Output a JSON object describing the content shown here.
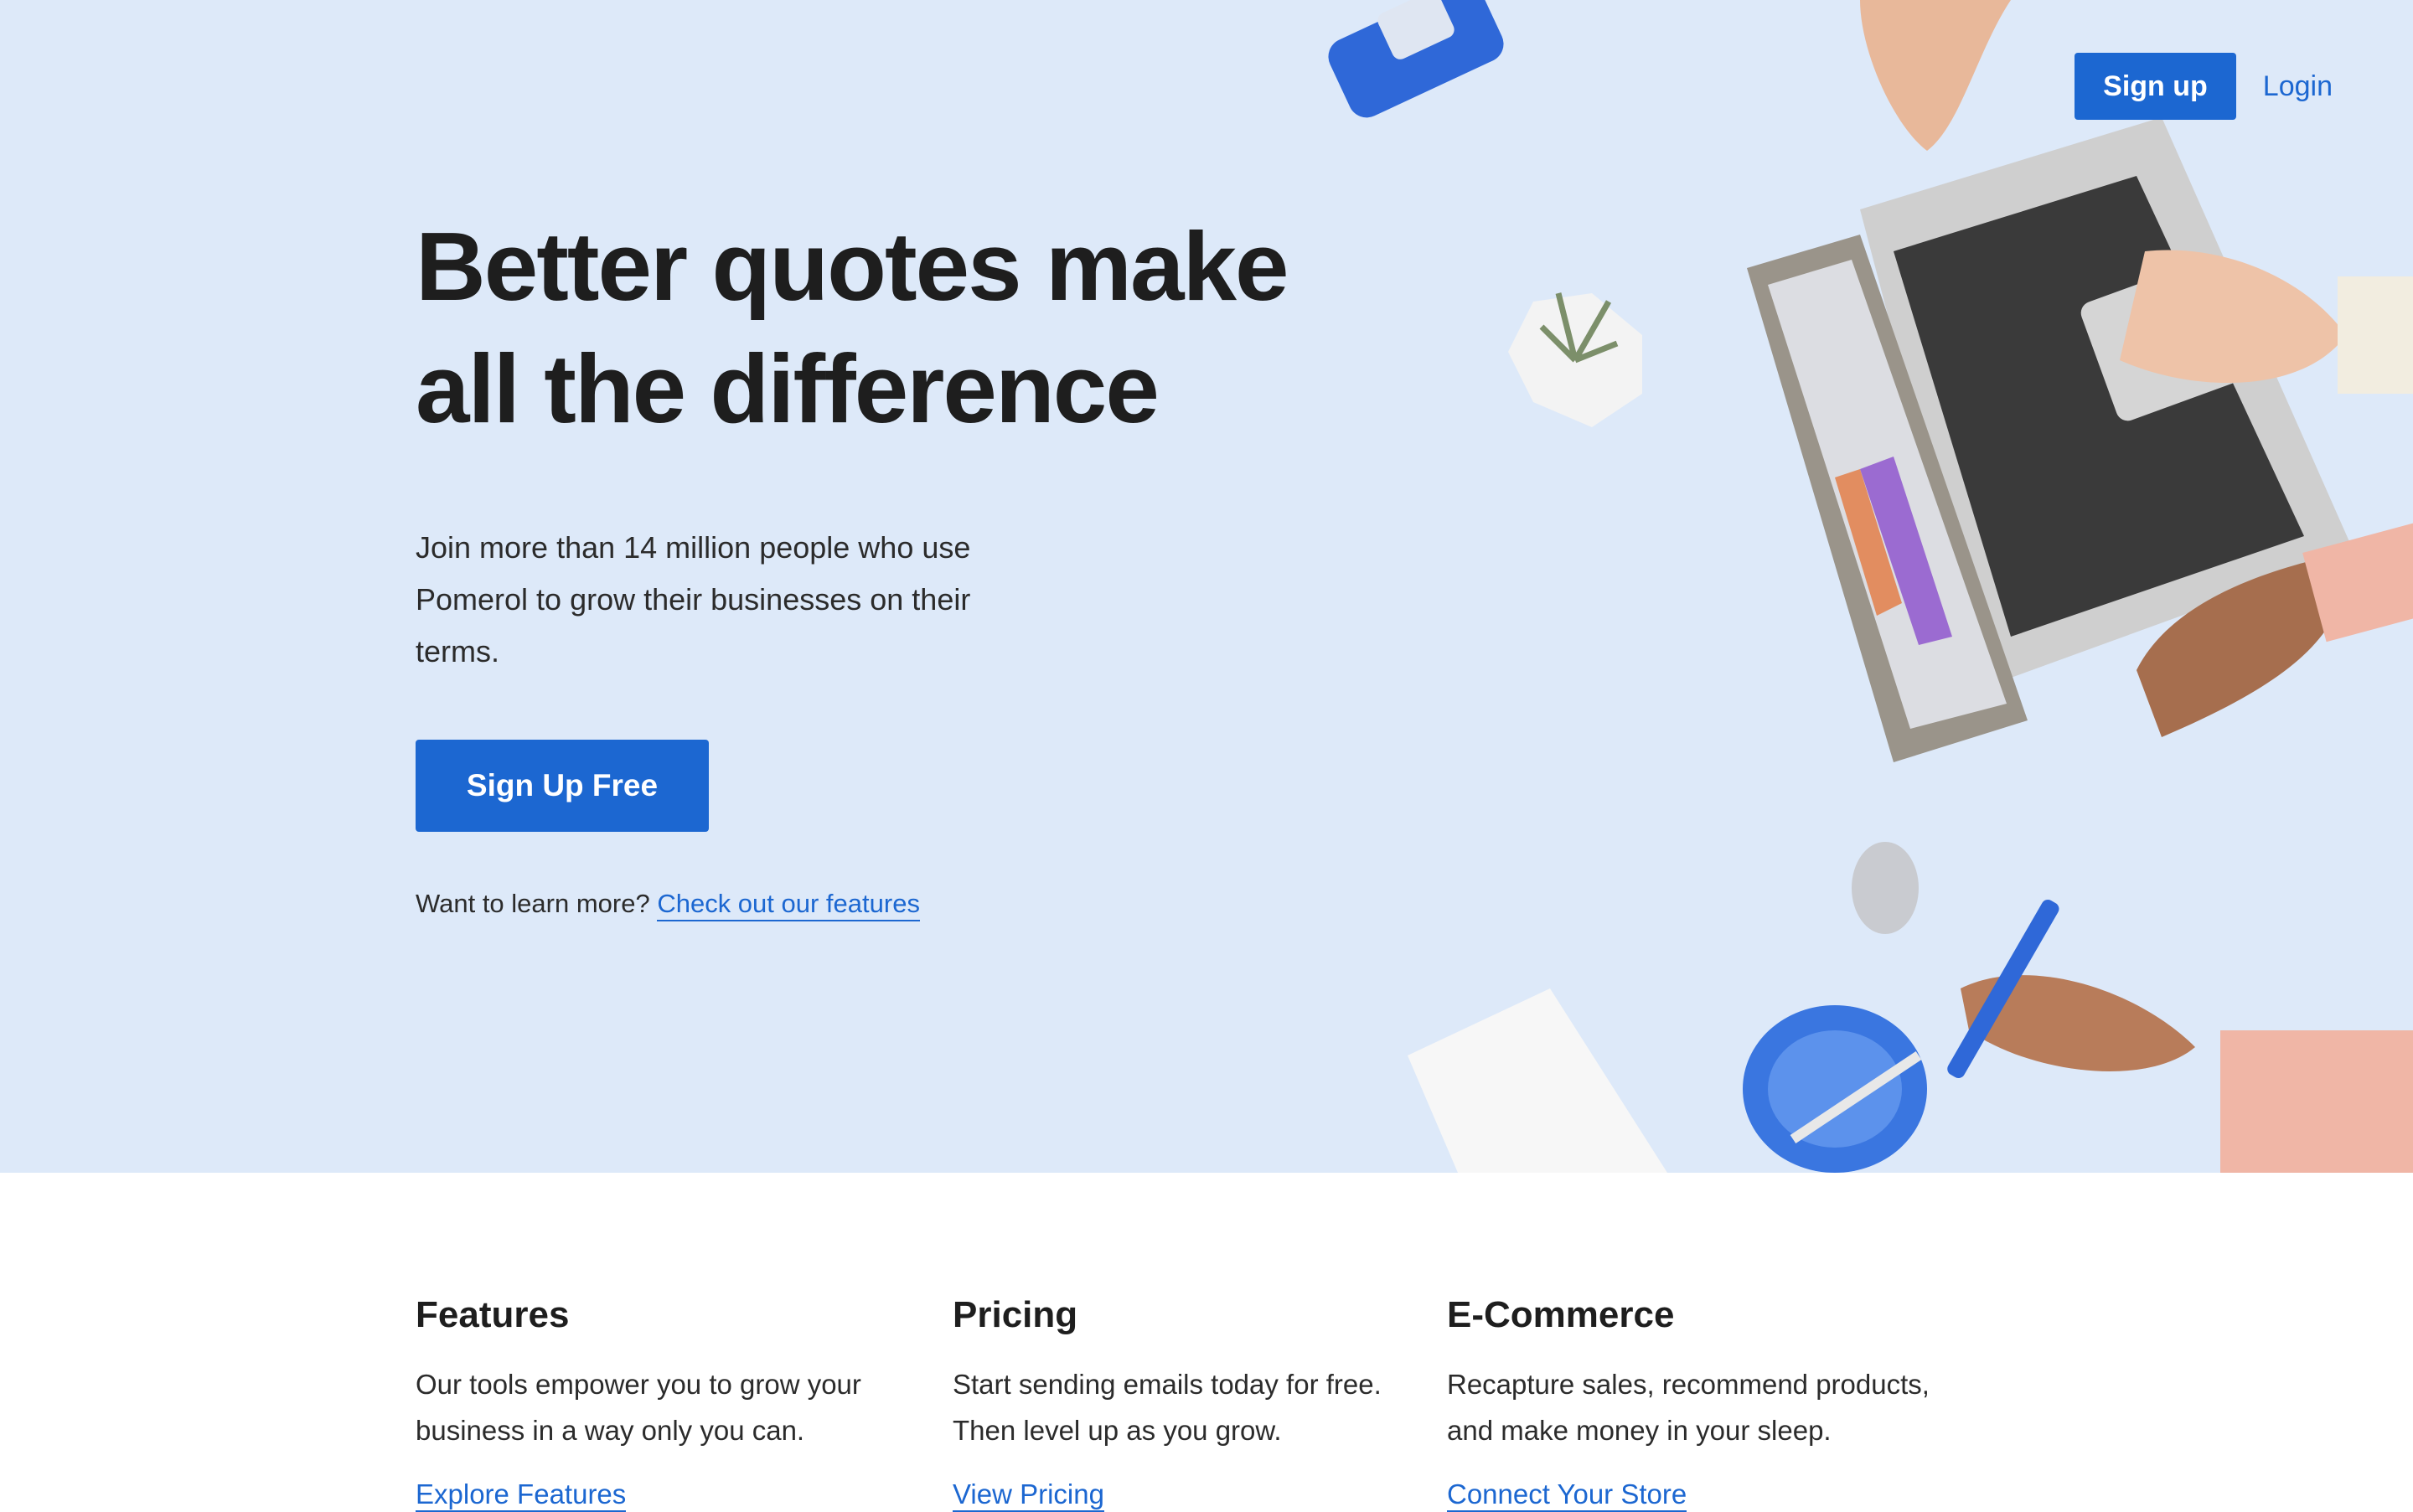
{
  "nav": {
    "signup_label": "Sign up",
    "login_label": "Login"
  },
  "hero": {
    "headline_line1": "Better quotes make",
    "headline_line2": "all the difference",
    "subtext": "Join more than 14 million people who use Pomerol to grow their businesses on their terms.",
    "cta_label": "Sign Up Free",
    "learn_prefix": "Want to learn more?",
    "learn_link": "Check out our features"
  },
  "columns": [
    {
      "title": "Features",
      "text": "Our tools empower you to grow your business in a way only you can.",
      "link": "Explore Features"
    },
    {
      "title": "Pricing",
      "text": "Start sending emails today for free. Then level up as you grow.",
      "link": "View Pricing"
    },
    {
      "title": "E-Commerce",
      "text": "Recapture sales, recommend products, and make money in your sleep.",
      "link": "Connect Your Store"
    }
  ],
  "colors": {
    "brand_blue": "#1c67d1",
    "hero_background": "#dde9f9"
  }
}
